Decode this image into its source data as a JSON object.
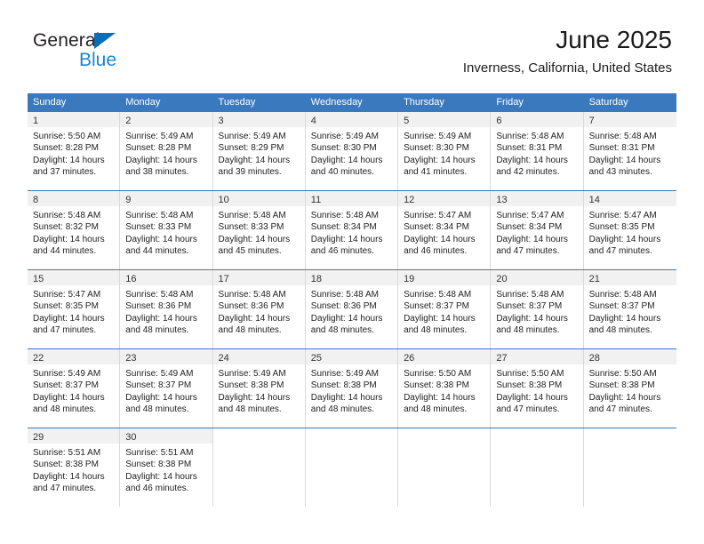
{
  "logo": {
    "word_top": "General",
    "word_bottom": "Blue",
    "triangle_color": "#0b6cb7",
    "blue_color": "#1a86d0"
  },
  "header": {
    "title": "June 2025",
    "subtitle": "Inverness, California, United States"
  },
  "theme": {
    "header_bar": "#3a79bd",
    "daynum_band": "#f1f1f1",
    "cell_border": "#d9d9d9"
  },
  "weekdays": [
    "Sunday",
    "Monday",
    "Tuesday",
    "Wednesday",
    "Thursday",
    "Friday",
    "Saturday"
  ],
  "weeks": [
    [
      {
        "day": "1",
        "sunrise": "Sunrise: 5:50 AM",
        "sunset": "Sunset: 8:28 PM",
        "daylight": "Daylight: 14 hours and 37 minutes."
      },
      {
        "day": "2",
        "sunrise": "Sunrise: 5:49 AM",
        "sunset": "Sunset: 8:28 PM",
        "daylight": "Daylight: 14 hours and 38 minutes."
      },
      {
        "day": "3",
        "sunrise": "Sunrise: 5:49 AM",
        "sunset": "Sunset: 8:29 PM",
        "daylight": "Daylight: 14 hours and 39 minutes."
      },
      {
        "day": "4",
        "sunrise": "Sunrise: 5:49 AM",
        "sunset": "Sunset: 8:30 PM",
        "daylight": "Daylight: 14 hours and 40 minutes."
      },
      {
        "day": "5",
        "sunrise": "Sunrise: 5:49 AM",
        "sunset": "Sunset: 8:30 PM",
        "daylight": "Daylight: 14 hours and 41 minutes."
      },
      {
        "day": "6",
        "sunrise": "Sunrise: 5:48 AM",
        "sunset": "Sunset: 8:31 PM",
        "daylight": "Daylight: 14 hours and 42 minutes."
      },
      {
        "day": "7",
        "sunrise": "Sunrise: 5:48 AM",
        "sunset": "Sunset: 8:31 PM",
        "daylight": "Daylight: 14 hours and 43 minutes."
      }
    ],
    [
      {
        "day": "8",
        "sunrise": "Sunrise: 5:48 AM",
        "sunset": "Sunset: 8:32 PM",
        "daylight": "Daylight: 14 hours and 44 minutes."
      },
      {
        "day": "9",
        "sunrise": "Sunrise: 5:48 AM",
        "sunset": "Sunset: 8:33 PM",
        "daylight": "Daylight: 14 hours and 44 minutes."
      },
      {
        "day": "10",
        "sunrise": "Sunrise: 5:48 AM",
        "sunset": "Sunset: 8:33 PM",
        "daylight": "Daylight: 14 hours and 45 minutes."
      },
      {
        "day": "11",
        "sunrise": "Sunrise: 5:48 AM",
        "sunset": "Sunset: 8:34 PM",
        "daylight": "Daylight: 14 hours and 46 minutes."
      },
      {
        "day": "12",
        "sunrise": "Sunrise: 5:47 AM",
        "sunset": "Sunset: 8:34 PM",
        "daylight": "Daylight: 14 hours and 46 minutes."
      },
      {
        "day": "13",
        "sunrise": "Sunrise: 5:47 AM",
        "sunset": "Sunset: 8:34 PM",
        "daylight": "Daylight: 14 hours and 47 minutes."
      },
      {
        "day": "14",
        "sunrise": "Sunrise: 5:47 AM",
        "sunset": "Sunset: 8:35 PM",
        "daylight": "Daylight: 14 hours and 47 minutes."
      }
    ],
    [
      {
        "day": "15",
        "sunrise": "Sunrise: 5:47 AM",
        "sunset": "Sunset: 8:35 PM",
        "daylight": "Daylight: 14 hours and 47 minutes."
      },
      {
        "day": "16",
        "sunrise": "Sunrise: 5:48 AM",
        "sunset": "Sunset: 8:36 PM",
        "daylight": "Daylight: 14 hours and 48 minutes."
      },
      {
        "day": "17",
        "sunrise": "Sunrise: 5:48 AM",
        "sunset": "Sunset: 8:36 PM",
        "daylight": "Daylight: 14 hours and 48 minutes."
      },
      {
        "day": "18",
        "sunrise": "Sunrise: 5:48 AM",
        "sunset": "Sunset: 8:36 PM",
        "daylight": "Daylight: 14 hours and 48 minutes."
      },
      {
        "day": "19",
        "sunrise": "Sunrise: 5:48 AM",
        "sunset": "Sunset: 8:37 PM",
        "daylight": "Daylight: 14 hours and 48 minutes."
      },
      {
        "day": "20",
        "sunrise": "Sunrise: 5:48 AM",
        "sunset": "Sunset: 8:37 PM",
        "daylight": "Daylight: 14 hours and 48 minutes."
      },
      {
        "day": "21",
        "sunrise": "Sunrise: 5:48 AM",
        "sunset": "Sunset: 8:37 PM",
        "daylight": "Daylight: 14 hours and 48 minutes."
      }
    ],
    [
      {
        "day": "22",
        "sunrise": "Sunrise: 5:49 AM",
        "sunset": "Sunset: 8:37 PM",
        "daylight": "Daylight: 14 hours and 48 minutes."
      },
      {
        "day": "23",
        "sunrise": "Sunrise: 5:49 AM",
        "sunset": "Sunset: 8:37 PM",
        "daylight": "Daylight: 14 hours and 48 minutes."
      },
      {
        "day": "24",
        "sunrise": "Sunrise: 5:49 AM",
        "sunset": "Sunset: 8:38 PM",
        "daylight": "Daylight: 14 hours and 48 minutes."
      },
      {
        "day": "25",
        "sunrise": "Sunrise: 5:49 AM",
        "sunset": "Sunset: 8:38 PM",
        "daylight": "Daylight: 14 hours and 48 minutes."
      },
      {
        "day": "26",
        "sunrise": "Sunrise: 5:50 AM",
        "sunset": "Sunset: 8:38 PM",
        "daylight": "Daylight: 14 hours and 48 minutes."
      },
      {
        "day": "27",
        "sunrise": "Sunrise: 5:50 AM",
        "sunset": "Sunset: 8:38 PM",
        "daylight": "Daylight: 14 hours and 47 minutes."
      },
      {
        "day": "28",
        "sunrise": "Sunrise: 5:50 AM",
        "sunset": "Sunset: 8:38 PM",
        "daylight": "Daylight: 14 hours and 47 minutes."
      }
    ],
    [
      {
        "day": "29",
        "sunrise": "Sunrise: 5:51 AM",
        "sunset": "Sunset: 8:38 PM",
        "daylight": "Daylight: 14 hours and 47 minutes."
      },
      {
        "day": "30",
        "sunrise": "Sunrise: 5:51 AM",
        "sunset": "Sunset: 8:38 PM",
        "daylight": "Daylight: 14 hours and 46 minutes."
      },
      {
        "day": "",
        "sunrise": "",
        "sunset": "",
        "daylight": ""
      },
      {
        "day": "",
        "sunrise": "",
        "sunset": "",
        "daylight": ""
      },
      {
        "day": "",
        "sunrise": "",
        "sunset": "",
        "daylight": ""
      },
      {
        "day": "",
        "sunrise": "",
        "sunset": "",
        "daylight": ""
      },
      {
        "day": "",
        "sunrise": "",
        "sunset": "",
        "daylight": ""
      }
    ]
  ]
}
